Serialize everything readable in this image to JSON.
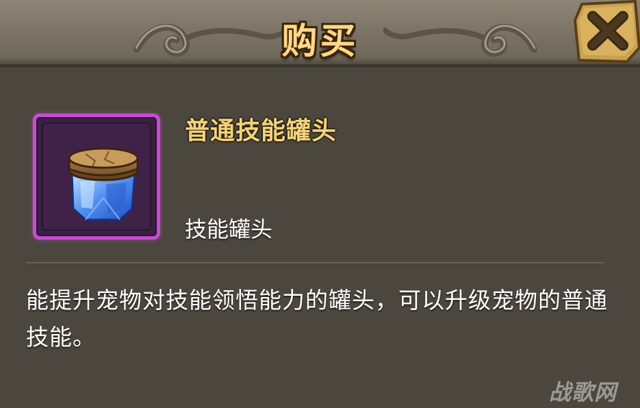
{
  "dialog": {
    "title": "购买",
    "close_icon": "close-x-icon"
  },
  "item": {
    "icon": "skill-jar-icon",
    "name": "普通技能罐头",
    "type": "技能罐头",
    "frame_color": "#c64ed2",
    "name_color": "#f3d37a"
  },
  "description": "能提升宠物对技能领悟能力的罐头，可以升级宠物的普通技能。",
  "watermark": "战歌网"
}
